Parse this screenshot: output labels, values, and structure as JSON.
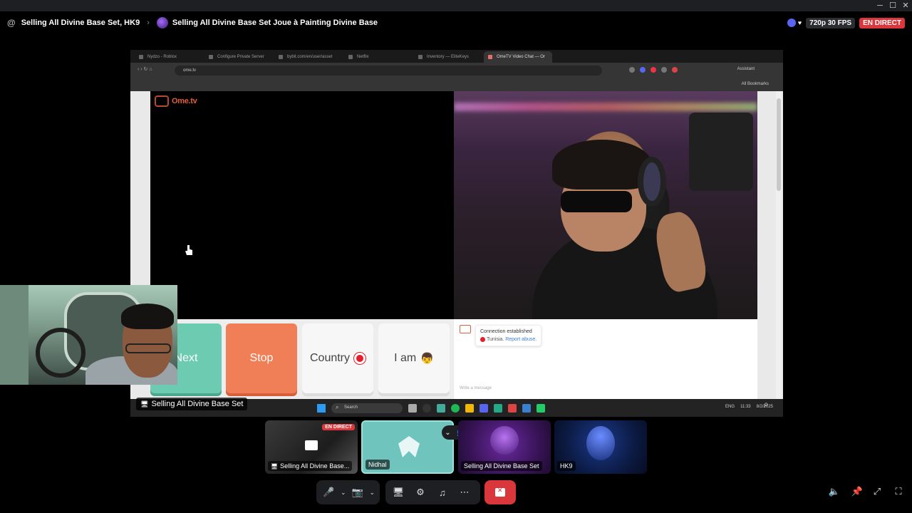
{
  "window": {
    "minimize": "─",
    "maximize": "☐",
    "close": "✕"
  },
  "header": {
    "title": "Selling All Divine Base Set, HK9",
    "channel": "Selling All Divine Base Set Joue à Painting Divine Base",
    "quality": "720p 30 FPS",
    "live": "EN DIRECT"
  },
  "browser": {
    "tabs": [
      "Nydzo - Roblox",
      "Configure Private Server",
      "bybit.com/en/user/asset",
      "Netflix",
      "Inventory — EliteKeys",
      "OmeTV Video Chat — Or"
    ],
    "url": "ome.tv",
    "assistant": "Assistant",
    "bookmarks": "All Bookmarks"
  },
  "ometv": {
    "logo": "Ome.tv",
    "buttons": {
      "next": "Next",
      "stop": "Stop",
      "country": "Country",
      "iam": "I am"
    },
    "chat": {
      "status": "Connection established",
      "country": "Tunisia.",
      "report": "Report abuse.",
      "placeholder": "Write a message"
    }
  },
  "taskbar": {
    "search": "Search",
    "lang": "ENG",
    "time": "11:33",
    "date": "8/2/2025"
  },
  "screen_label": "Selling All Divine Base Set",
  "tiles": [
    {
      "label": "Selling All Divine Base...",
      "badge": "EN DIRECT"
    },
    {
      "label": "Nidhal"
    },
    {
      "label": "Selling All Divine Base Set"
    },
    {
      "label": "HK9"
    }
  ],
  "icons": {
    "mic": "🎤",
    "camera-off": "📷",
    "screen-share": "🖥",
    "activities": "⚙",
    "soundboard": "♫",
    "more": "⋯",
    "hangup": "✕",
    "volume": "🔈",
    "pin": "📌",
    "popout": "⤢",
    "fullscreen": "⛶"
  },
  "colors": {
    "live": "#da373c",
    "next": "#6ccbb0",
    "stop": "#f07e56",
    "ometv_brand": "#e25d3a"
  }
}
